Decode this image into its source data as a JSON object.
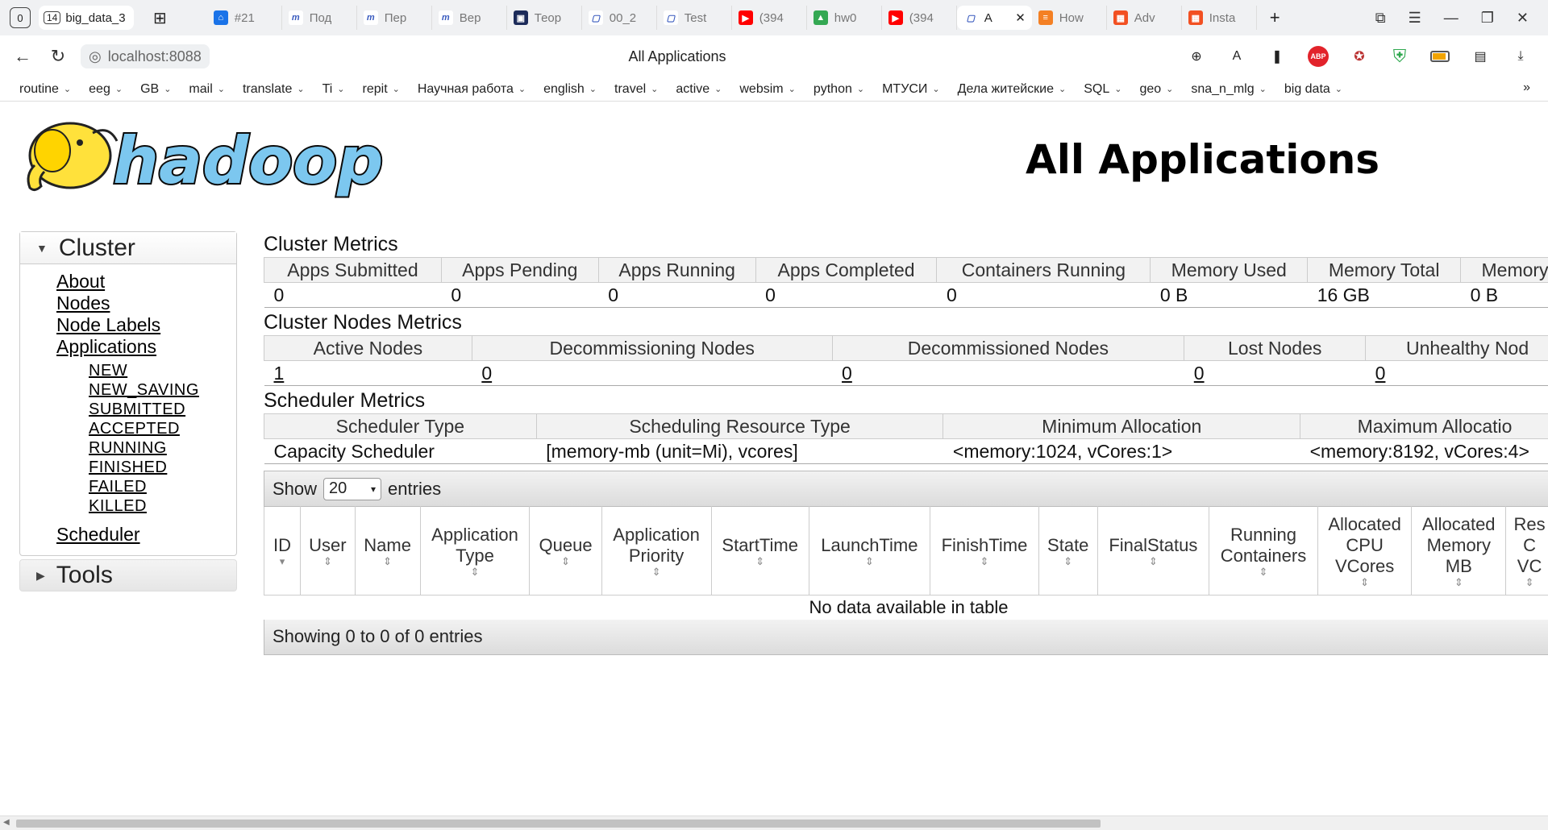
{
  "browser": {
    "tab_counter": "0",
    "group_tab": {
      "count": "14",
      "label": "big_data_3"
    },
    "tabs": [
      {
        "label": "#21",
        "color": "#1a73e8",
        "glyph": "⌂"
      },
      {
        "label": "Под",
        "color": "#ffffff",
        "glyph": "m"
      },
      {
        "label": "Пер",
        "color": "#ffffff",
        "glyph": "m"
      },
      {
        "label": "Вер",
        "color": "#ffffff",
        "glyph": "m"
      },
      {
        "label": "Теор",
        "color": "#1c2b5a",
        "glyph": "▣"
      },
      {
        "label": "00_2",
        "color": "#ffffff",
        "glyph": "▢"
      },
      {
        "label": "Test",
        "color": "#ffffff",
        "glyph": "▢"
      },
      {
        "label": "(394",
        "color": "#ff0000",
        "glyph": "▶"
      },
      {
        "label": "hw0",
        "color": "#34a853",
        "glyph": "▲"
      },
      {
        "label": "(394",
        "color": "#ff0000",
        "glyph": "▶"
      },
      {
        "label": "A",
        "color": "#ffffff",
        "glyph": "▢",
        "active": true
      },
      {
        "label": "How",
        "color": "#f48024",
        "glyph": "≡"
      },
      {
        "label": "Adv",
        "color": "#f25022",
        "glyph": "▦"
      },
      {
        "label": "Insta",
        "color": "#f25022",
        "glyph": "▦"
      }
    ],
    "url": "localhost:8088",
    "page_title": "All Applications",
    "bookmarks": [
      "routine",
      "eeg",
      "GB",
      "mail",
      "translate",
      "Ti",
      "repit",
      "Научная работа",
      "english",
      "travel",
      "active",
      "websim",
      "python",
      "МТУСИ",
      "Дела житейские",
      "SQL",
      "geo",
      "sna_n_mlg",
      "big data"
    ]
  },
  "page": {
    "heading": "All Applications",
    "logo_text": "hadoop"
  },
  "sidebar": {
    "cluster_label": "Cluster",
    "links": [
      "About",
      "Nodes",
      "Node Labels",
      "Applications"
    ],
    "app_states": [
      "NEW",
      "NEW_SAVING",
      "SUBMITTED",
      "ACCEPTED",
      "RUNNING",
      "FINISHED",
      "FAILED",
      "KILLED"
    ],
    "scheduler_label": "Scheduler",
    "tools_label": "Tools"
  },
  "cluster_metrics": {
    "title": "Cluster Metrics",
    "headers": [
      "Apps Submitted",
      "Apps Pending",
      "Apps Running",
      "Apps Completed",
      "Containers Running",
      "Memory Used",
      "Memory Total",
      "Memory"
    ],
    "values": [
      "0",
      "0",
      "0",
      "0",
      "0",
      "0 B",
      "16 GB",
      "0 B"
    ]
  },
  "nodes_metrics": {
    "title": "Cluster Nodes Metrics",
    "headers": [
      "Active Nodes",
      "Decommissioning Nodes",
      "Decommissioned Nodes",
      "Lost Nodes",
      "Unhealthy Nod"
    ],
    "values": [
      "1",
      "0",
      "0",
      "0",
      "0"
    ]
  },
  "scheduler_metrics": {
    "title": "Scheduler Metrics",
    "headers": [
      "Scheduler Type",
      "Scheduling Resource Type",
      "Minimum Allocation",
      "Maximum Allocatio"
    ],
    "values": [
      "Capacity Scheduler",
      "[memory-mb (unit=Mi), vcores]",
      "<memory:1024, vCores:1>",
      "<memory:8192, vCores:4>"
    ]
  },
  "apps_table": {
    "show_label": "Show",
    "entries_value": "20",
    "entries_label": "entries",
    "columns": [
      "ID",
      "User",
      "Name",
      "Application Type",
      "Queue",
      "Application Priority",
      "StartTime",
      "LaunchTime",
      "FinishTime",
      "State",
      "FinalStatus",
      "Running Containers",
      "Allocated CPU VCores",
      "Allocated Memory MB",
      "Res C VC"
    ],
    "empty_message": "No data available in table",
    "footer": "Showing 0 to 0 of 0 entries"
  }
}
